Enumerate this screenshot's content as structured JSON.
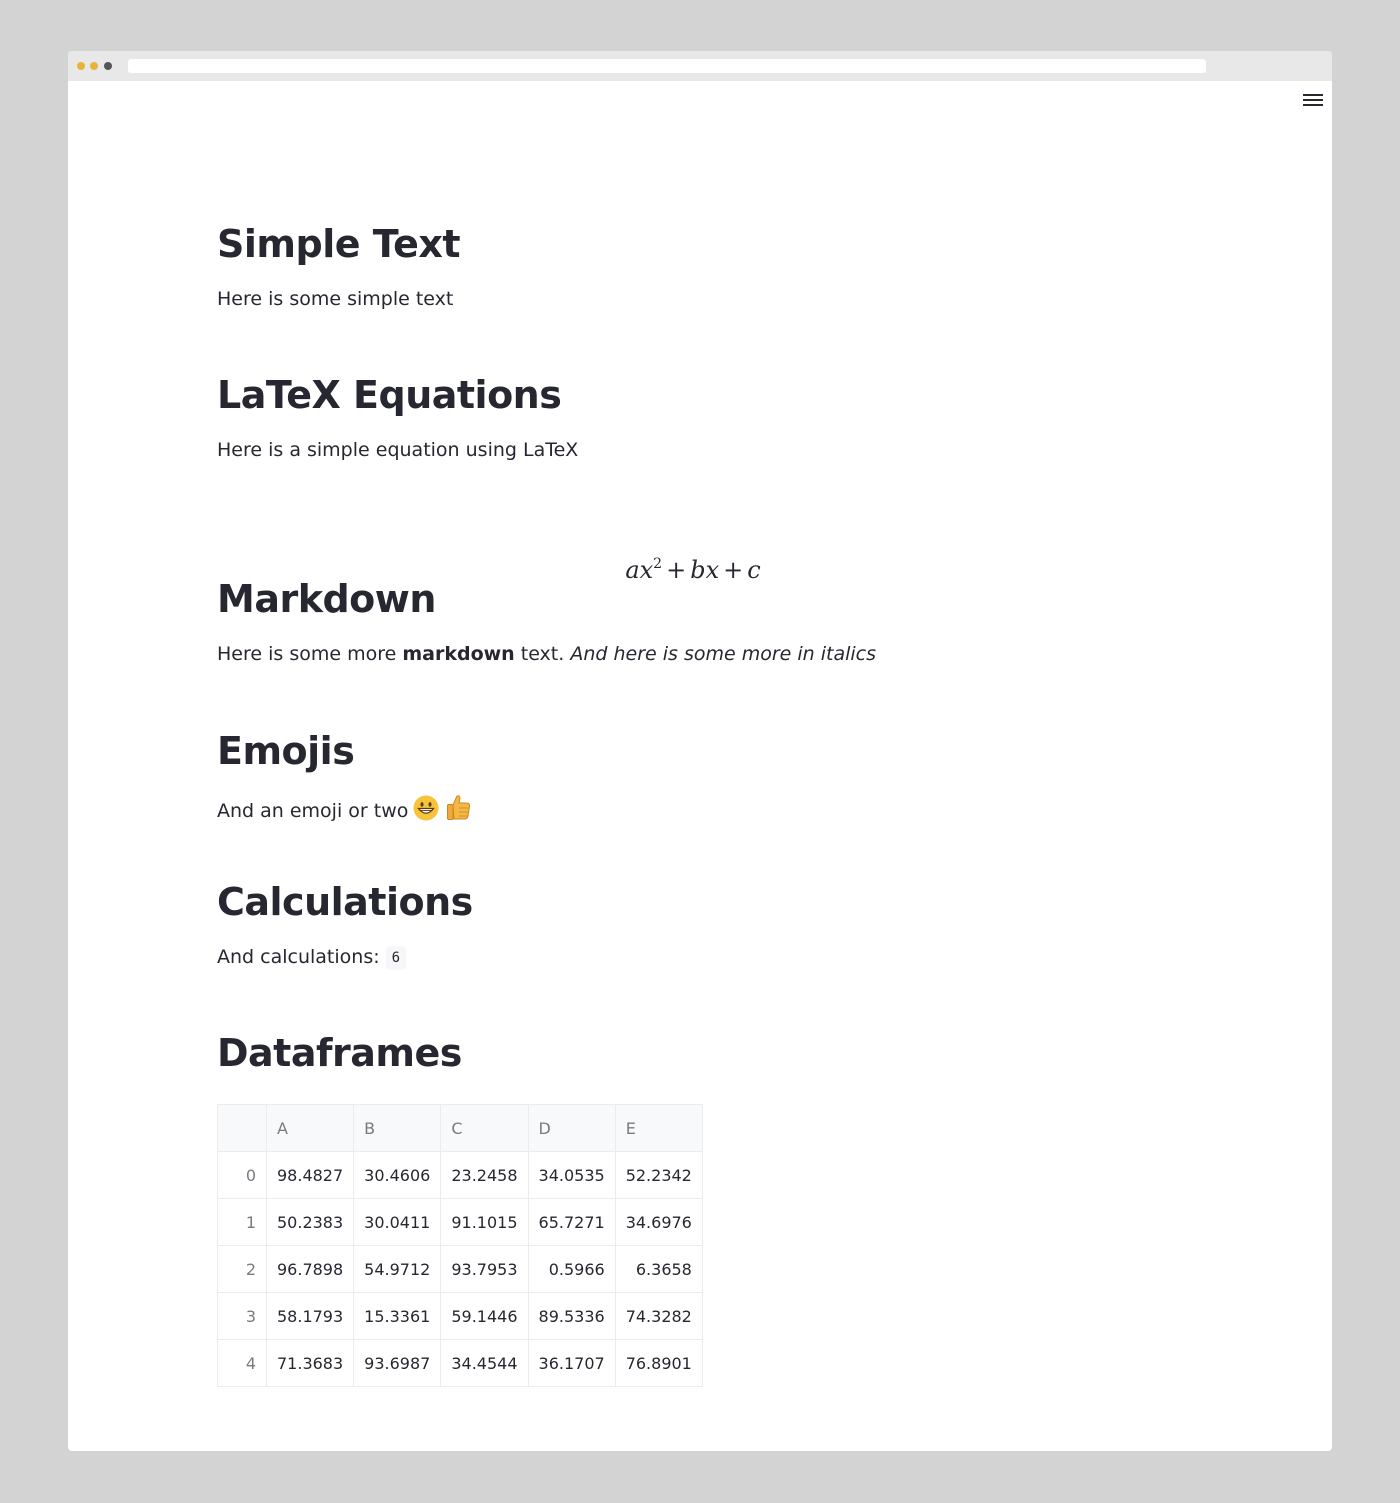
{
  "browser": {
    "window_dots": [
      "close",
      "minimize",
      "maximize"
    ]
  },
  "menu": {
    "icon": "hamburger-menu-icon"
  },
  "sections": {
    "simple_text": {
      "heading": "Simple Text",
      "body": "Here is some simple text"
    },
    "latex": {
      "heading": "LaTeX Equations",
      "body": "Here is a simple equation using LaTeX",
      "equation": {
        "a": "a",
        "x": "x",
        "exp": "2",
        "plus1": "+",
        "b": "b",
        "x2": "x",
        "plus2": "+",
        "c": "c"
      }
    },
    "markdown": {
      "heading": "Markdown",
      "body_prefix": "Here is some more ",
      "body_bold": "markdown",
      "body_mid": " text. ",
      "body_italic": "And here is some more in italics"
    },
    "emojis": {
      "heading": "Emojis",
      "body": "And an emoji or two",
      "emoji_icons": [
        "grinning-face-icon",
        "thumbs-up-icon"
      ]
    },
    "calculations": {
      "heading": "Calculations",
      "body": "And calculations:",
      "result": "6"
    },
    "dataframes": {
      "heading": "Dataframes",
      "columns": [
        "A",
        "B",
        "C",
        "D",
        "E"
      ],
      "rows": [
        {
          "index": "0",
          "values": [
            "98.4827",
            "30.4606",
            "23.2458",
            "34.0535",
            "52.2342"
          ]
        },
        {
          "index": "1",
          "values": [
            "50.2383",
            "30.0411",
            "91.1015",
            "65.7271",
            "34.6976"
          ]
        },
        {
          "index": "2",
          "values": [
            "96.7898",
            "54.9712",
            "93.7953",
            "0.5966",
            "6.3658"
          ]
        },
        {
          "index": "3",
          "values": [
            "58.1793",
            "15.3361",
            "59.1446",
            "89.5336",
            "74.3282"
          ]
        },
        {
          "index": "4",
          "values": [
            "71.3683",
            "93.6987",
            "34.4544",
            "36.1707",
            "76.8901"
          ]
        }
      ]
    }
  }
}
